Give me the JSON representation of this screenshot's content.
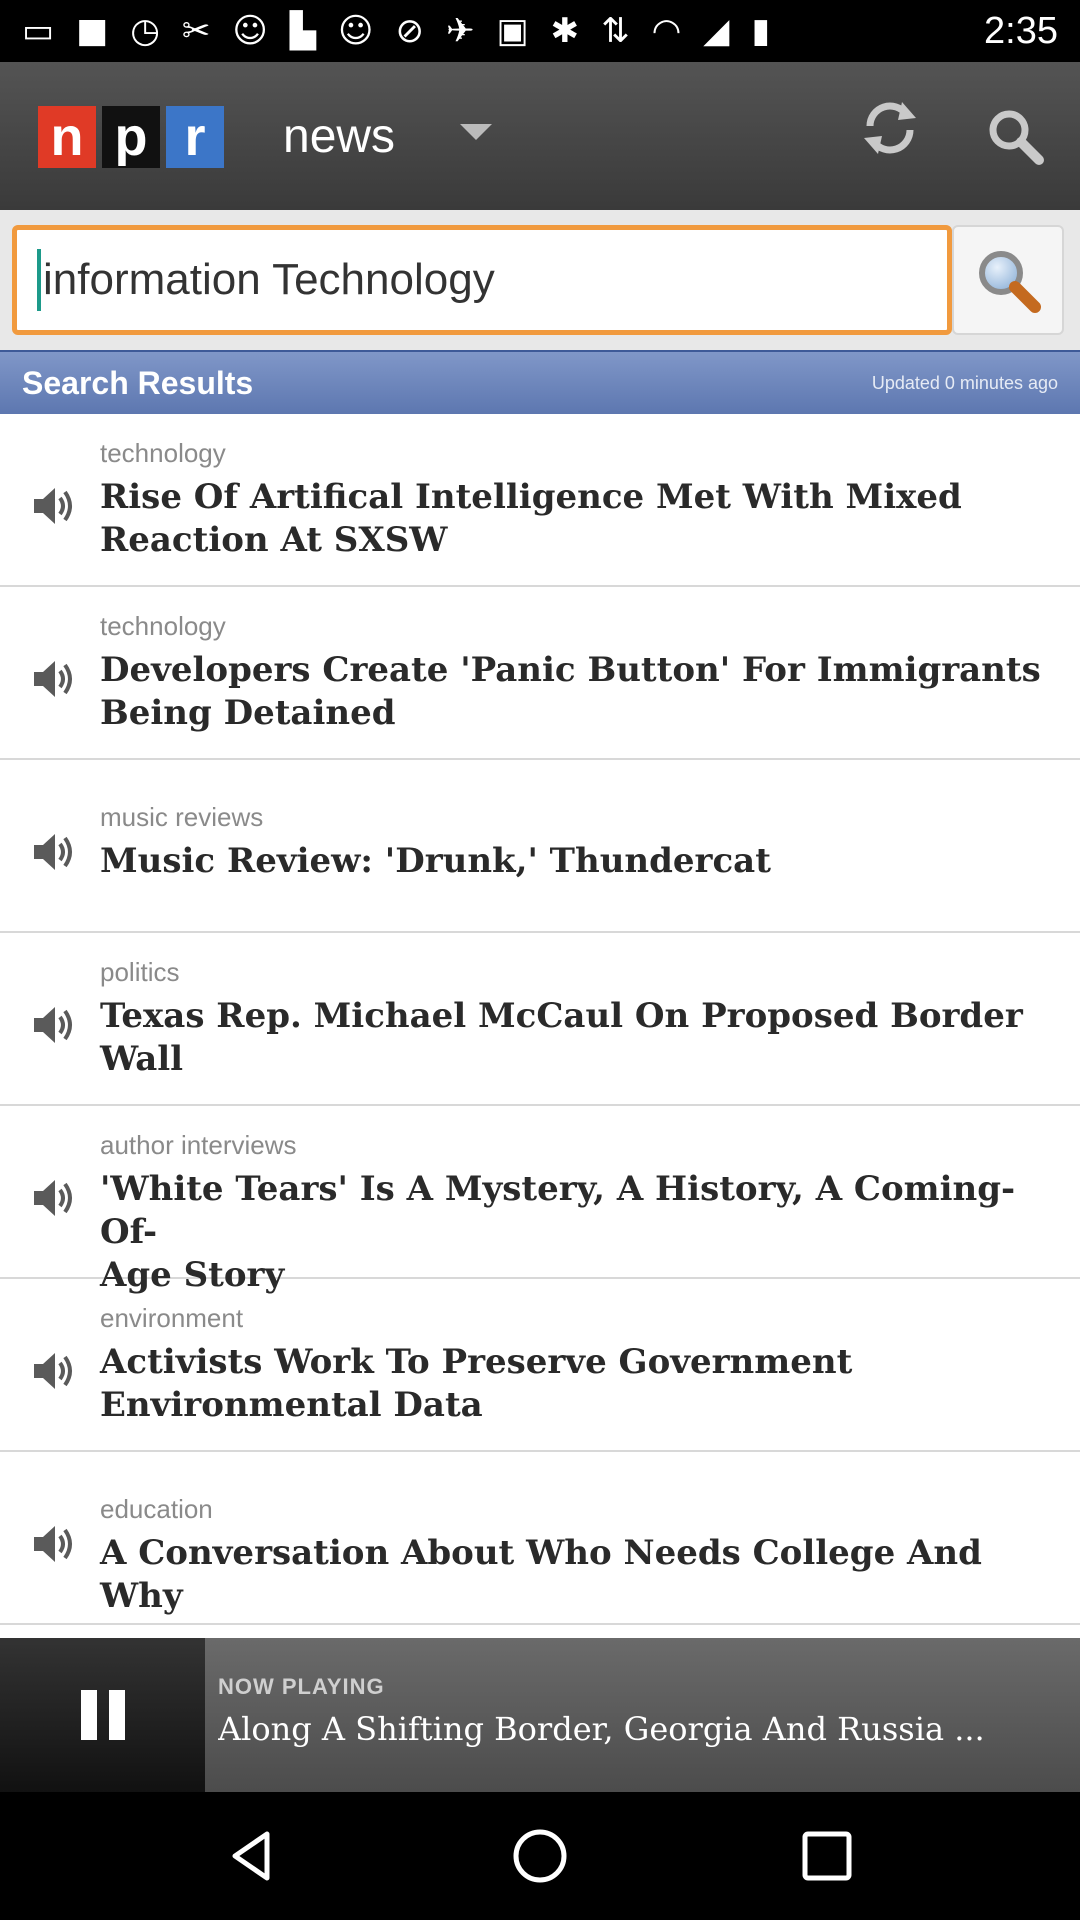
{
  "status_bar": {
    "time": "2:35",
    "icons": [
      "message-icon",
      "square-icon",
      "timer-icon",
      "wrench-icon",
      "smiley-icon",
      "flipboard-icon",
      "smiley-icon",
      "alarm-icon",
      "fake-gps-icon",
      "lock-icon",
      "bluetooth-icon",
      "data-icon",
      "wifi-icon",
      "signal-icon",
      "battery-icon"
    ]
  },
  "app_bar": {
    "logo": {
      "n": "n",
      "p": "p",
      "r": "r"
    },
    "section": "news"
  },
  "search": {
    "value": "information Technology"
  },
  "results_header": {
    "title": "Search Results",
    "updated": "Updated 0 minutes ago"
  },
  "stories": [
    {
      "category": "technology",
      "headline_lines": [
        "Rise Of Artifical Intelligence Met With Mixed",
        "Reaction At SXSW"
      ]
    },
    {
      "category": "technology",
      "headline_lines": [
        "Developers Create 'Panic Button' For Immigrants",
        "Being Detained"
      ]
    },
    {
      "category": "music reviews",
      "headline_lines": [
        "Music Review: 'Drunk,' Thundercat"
      ]
    },
    {
      "category": "politics",
      "headline_lines": [
        "Texas Rep. Michael McCaul On Proposed Border",
        "Wall"
      ]
    },
    {
      "category": "author interviews",
      "headline_lines": [
        "'White Tears' Is A Mystery, A History, A Coming-Of-",
        "Age Story"
      ]
    },
    {
      "category": "environment",
      "headline_lines": [
        "Activists Work To Preserve Government",
        "Environmental Data"
      ]
    },
    {
      "category": "education",
      "headline_lines": [
        "A Conversation About Who Needs College And Why"
      ]
    }
  ],
  "now_playing": {
    "label": "NOW PLAYING",
    "title": "Along A Shifting Border, Georgia And Russia ..."
  },
  "colors": {
    "accent_orange": "#f19a3e",
    "npr_red": "#e03a26",
    "npr_blue": "#3c76c8",
    "header_blue": "#6a82b8"
  }
}
